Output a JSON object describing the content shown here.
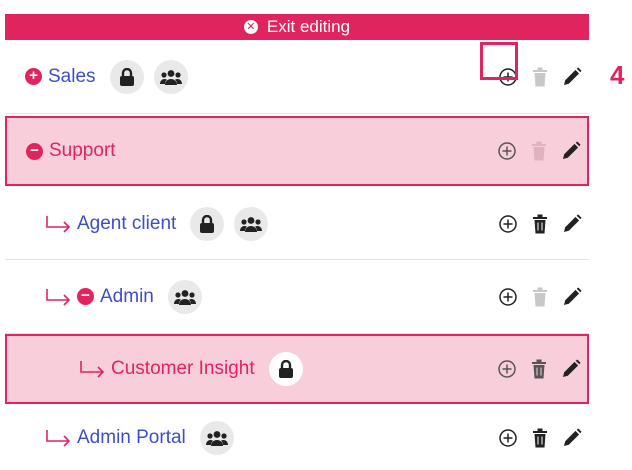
{
  "exit_bar": {
    "label": "Exit editing"
  },
  "callout": {
    "step": "4"
  },
  "rows": [
    {
      "label": "Sales",
      "level": 0,
      "toggle": "plus",
      "lock": true,
      "group": true,
      "highlighted": false,
      "delete_enabled": false
    },
    {
      "label": "Support",
      "level": 0,
      "toggle": "minus",
      "lock": false,
      "group": false,
      "highlighted": true,
      "delete_enabled": false
    },
    {
      "label": "Agent client",
      "level": 1,
      "toggle": "none",
      "lock": true,
      "group": true,
      "highlighted": false,
      "delete_enabled": true
    },
    {
      "label": "Admin",
      "level": 1,
      "toggle": "minus",
      "lock": false,
      "group": true,
      "highlighted": false,
      "delete_enabled": false
    },
    {
      "label": "Customer Insight",
      "level": 2,
      "toggle": "none",
      "lock": true,
      "group": false,
      "highlighted": true,
      "delete_enabled": true
    },
    {
      "label": "Admin Portal",
      "level": 1,
      "toggle": "none",
      "lock": false,
      "group": true,
      "highlighted": false,
      "delete_enabled": true
    }
  ],
  "colors": {
    "accent": "#e0245e",
    "link": "#3c4fc8",
    "highlight_bg": "#f8cedb",
    "icon_dark": "#222222",
    "icon_muted": "#c8c8c8",
    "badge_bg": "#e9e9e9"
  },
  "icons": {
    "add": "plus-circle-icon",
    "delete": "trash-icon",
    "edit": "pencil-icon",
    "lock": "lock-icon",
    "group": "users-icon",
    "indent": "indent-arrow-icon"
  }
}
